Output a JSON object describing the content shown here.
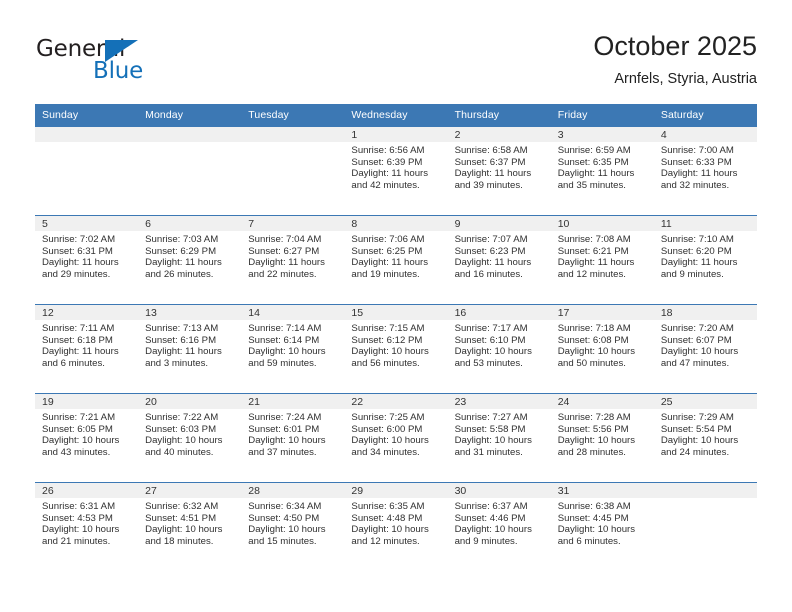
{
  "brand": {
    "name_top": "General",
    "name_bottom": "Blue",
    "triangle_color": "#1470b8",
    "text_color": "#231f20"
  },
  "header": {
    "title": "October 2025",
    "subtitle": "Arnfels, Styria, Austria"
  },
  "theme": {
    "header_blue": "#3c78b4",
    "row_divider": "#3c78b4",
    "daynum_band": "#f0f0f0",
    "text": "#303030"
  },
  "weekday_headers": [
    "Sunday",
    "Monday",
    "Tuesday",
    "Wednesday",
    "Thursday",
    "Friday",
    "Saturday"
  ],
  "labels": {
    "sunrise_prefix": "Sunrise:",
    "sunset_prefix": "Sunset:",
    "daylight_prefix": "Daylight:"
  },
  "weeks": [
    [
      {
        "day": "",
        "empty": true
      },
      {
        "day": "",
        "empty": true
      },
      {
        "day": "",
        "empty": true
      },
      {
        "day": "1",
        "sunrise": "Sunrise: 6:56 AM",
        "sunset": "Sunset: 6:39 PM",
        "daylight_l1": "Daylight: 11 hours",
        "daylight_l2": "and 42 minutes."
      },
      {
        "day": "2",
        "sunrise": "Sunrise: 6:58 AM",
        "sunset": "Sunset: 6:37 PM",
        "daylight_l1": "Daylight: 11 hours",
        "daylight_l2": "and 39 minutes."
      },
      {
        "day": "3",
        "sunrise": "Sunrise: 6:59 AM",
        "sunset": "Sunset: 6:35 PM",
        "daylight_l1": "Daylight: 11 hours",
        "daylight_l2": "and 35 minutes."
      },
      {
        "day": "4",
        "sunrise": "Sunrise: 7:00 AM",
        "sunset": "Sunset: 6:33 PM",
        "daylight_l1": "Daylight: 11 hours",
        "daylight_l2": "and 32 minutes."
      }
    ],
    [
      {
        "day": "5",
        "sunrise": "Sunrise: 7:02 AM",
        "sunset": "Sunset: 6:31 PM",
        "daylight_l1": "Daylight: 11 hours",
        "daylight_l2": "and 29 minutes."
      },
      {
        "day": "6",
        "sunrise": "Sunrise: 7:03 AM",
        "sunset": "Sunset: 6:29 PM",
        "daylight_l1": "Daylight: 11 hours",
        "daylight_l2": "and 26 minutes."
      },
      {
        "day": "7",
        "sunrise": "Sunrise: 7:04 AM",
        "sunset": "Sunset: 6:27 PM",
        "daylight_l1": "Daylight: 11 hours",
        "daylight_l2": "and 22 minutes."
      },
      {
        "day": "8",
        "sunrise": "Sunrise: 7:06 AM",
        "sunset": "Sunset: 6:25 PM",
        "daylight_l1": "Daylight: 11 hours",
        "daylight_l2": "and 19 minutes."
      },
      {
        "day": "9",
        "sunrise": "Sunrise: 7:07 AM",
        "sunset": "Sunset: 6:23 PM",
        "daylight_l1": "Daylight: 11 hours",
        "daylight_l2": "and 16 minutes."
      },
      {
        "day": "10",
        "sunrise": "Sunrise: 7:08 AM",
        "sunset": "Sunset: 6:21 PM",
        "daylight_l1": "Daylight: 11 hours",
        "daylight_l2": "and 12 minutes."
      },
      {
        "day": "11",
        "sunrise": "Sunrise: 7:10 AM",
        "sunset": "Sunset: 6:20 PM",
        "daylight_l1": "Daylight: 11 hours",
        "daylight_l2": "and 9 minutes."
      }
    ],
    [
      {
        "day": "12",
        "sunrise": "Sunrise: 7:11 AM",
        "sunset": "Sunset: 6:18 PM",
        "daylight_l1": "Daylight: 11 hours",
        "daylight_l2": "and 6 minutes."
      },
      {
        "day": "13",
        "sunrise": "Sunrise: 7:13 AM",
        "sunset": "Sunset: 6:16 PM",
        "daylight_l1": "Daylight: 11 hours",
        "daylight_l2": "and 3 minutes."
      },
      {
        "day": "14",
        "sunrise": "Sunrise: 7:14 AM",
        "sunset": "Sunset: 6:14 PM",
        "daylight_l1": "Daylight: 10 hours",
        "daylight_l2": "and 59 minutes."
      },
      {
        "day": "15",
        "sunrise": "Sunrise: 7:15 AM",
        "sunset": "Sunset: 6:12 PM",
        "daylight_l1": "Daylight: 10 hours",
        "daylight_l2": "and 56 minutes."
      },
      {
        "day": "16",
        "sunrise": "Sunrise: 7:17 AM",
        "sunset": "Sunset: 6:10 PM",
        "daylight_l1": "Daylight: 10 hours",
        "daylight_l2": "and 53 minutes."
      },
      {
        "day": "17",
        "sunrise": "Sunrise: 7:18 AM",
        "sunset": "Sunset: 6:08 PM",
        "daylight_l1": "Daylight: 10 hours",
        "daylight_l2": "and 50 minutes."
      },
      {
        "day": "18",
        "sunrise": "Sunrise: 7:20 AM",
        "sunset": "Sunset: 6:07 PM",
        "daylight_l1": "Daylight: 10 hours",
        "daylight_l2": "and 47 minutes."
      }
    ],
    [
      {
        "day": "19",
        "sunrise": "Sunrise: 7:21 AM",
        "sunset": "Sunset: 6:05 PM",
        "daylight_l1": "Daylight: 10 hours",
        "daylight_l2": "and 43 minutes."
      },
      {
        "day": "20",
        "sunrise": "Sunrise: 7:22 AM",
        "sunset": "Sunset: 6:03 PM",
        "daylight_l1": "Daylight: 10 hours",
        "daylight_l2": "and 40 minutes."
      },
      {
        "day": "21",
        "sunrise": "Sunrise: 7:24 AM",
        "sunset": "Sunset: 6:01 PM",
        "daylight_l1": "Daylight: 10 hours",
        "daylight_l2": "and 37 minutes."
      },
      {
        "day": "22",
        "sunrise": "Sunrise: 7:25 AM",
        "sunset": "Sunset: 6:00 PM",
        "daylight_l1": "Daylight: 10 hours",
        "daylight_l2": "and 34 minutes."
      },
      {
        "day": "23",
        "sunrise": "Sunrise: 7:27 AM",
        "sunset": "Sunset: 5:58 PM",
        "daylight_l1": "Daylight: 10 hours",
        "daylight_l2": "and 31 minutes."
      },
      {
        "day": "24",
        "sunrise": "Sunrise: 7:28 AM",
        "sunset": "Sunset: 5:56 PM",
        "daylight_l1": "Daylight: 10 hours",
        "daylight_l2": "and 28 minutes."
      },
      {
        "day": "25",
        "sunrise": "Sunrise: 7:29 AM",
        "sunset": "Sunset: 5:54 PM",
        "daylight_l1": "Daylight: 10 hours",
        "daylight_l2": "and 24 minutes."
      }
    ],
    [
      {
        "day": "26",
        "sunrise": "Sunrise: 6:31 AM",
        "sunset": "Sunset: 4:53 PM",
        "daylight_l1": "Daylight: 10 hours",
        "daylight_l2": "and 21 minutes."
      },
      {
        "day": "27",
        "sunrise": "Sunrise: 6:32 AM",
        "sunset": "Sunset: 4:51 PM",
        "daylight_l1": "Daylight: 10 hours",
        "daylight_l2": "and 18 minutes."
      },
      {
        "day": "28",
        "sunrise": "Sunrise: 6:34 AM",
        "sunset": "Sunset: 4:50 PM",
        "daylight_l1": "Daylight: 10 hours",
        "daylight_l2": "and 15 minutes."
      },
      {
        "day": "29",
        "sunrise": "Sunrise: 6:35 AM",
        "sunset": "Sunset: 4:48 PM",
        "daylight_l1": "Daylight: 10 hours",
        "daylight_l2": "and 12 minutes."
      },
      {
        "day": "30",
        "sunrise": "Sunrise: 6:37 AM",
        "sunset": "Sunset: 4:46 PM",
        "daylight_l1": "Daylight: 10 hours",
        "daylight_l2": "and 9 minutes."
      },
      {
        "day": "31",
        "sunrise": "Sunrise: 6:38 AM",
        "sunset": "Sunset: 4:45 PM",
        "daylight_l1": "Daylight: 10 hours",
        "daylight_l2": "and 6 minutes."
      },
      {
        "day": "",
        "empty": true,
        "trailing": true
      }
    ]
  ]
}
